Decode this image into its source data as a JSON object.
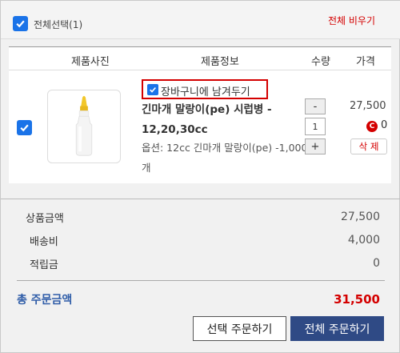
{
  "header": {
    "select_all_label": "전체선택(1)",
    "clear_all_label": "전체 비우기"
  },
  "table": {
    "columns": [
      "제품사진",
      "제품정보",
      "수량",
      "가격"
    ]
  },
  "item": {
    "checked": true,
    "keep_in_cart_label": "장바구니에 남겨두기",
    "name": "긴마개 말랑이(pe) 시럽병 - 12,20,30cc",
    "option": "옵션: 12cc 긴마개 말랑이(pe) -1,000개",
    "qty_minus": "-",
    "quantity": "1",
    "qty_plus": "+",
    "price": "27,500",
    "point_icon": "C",
    "points": "0",
    "delete_label": "삭 제"
  },
  "summary": {
    "goods_label": "상품금액",
    "goods_value": "27,500",
    "shipping_label": "배송비",
    "shipping_value": "4,000",
    "points_label": "적립금",
    "points_value": "0",
    "total_label": "총 주문금액",
    "total_value": "31,500"
  },
  "buttons": {
    "order_selected": "선택 주문하기",
    "order_all": "전체 주문하기"
  },
  "colors": {
    "accent_blue": "#1a73e8",
    "red": "#d40000",
    "primary_button": "#2f4a85"
  }
}
